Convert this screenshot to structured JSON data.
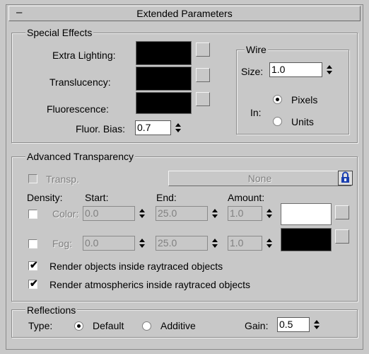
{
  "rollout": {
    "title": "Extended Parameters",
    "collapse_symbol": "–"
  },
  "special_effects": {
    "title": "Special Effects",
    "extra_lighting_label": "Extra Lighting:",
    "translucency_label": "Translucency:",
    "fluorescence_label": "Fluorescence:",
    "fluor_bias_label": "Fluor. Bias:",
    "fluor_bias_value": "0.7",
    "extra_lighting_color": "#000000",
    "translucency_color": "#000000",
    "fluorescence_color": "#000000"
  },
  "wire": {
    "title": "Wire",
    "size_label": "Size:",
    "size_value": "1.0",
    "in_label": "In:",
    "pixels_label": "Pixels",
    "units_label": "Units",
    "selected": "Pixels"
  },
  "advanced_transparency": {
    "title": "Advanced Transparency",
    "transp_label": "Transp.",
    "none_label": "None",
    "density_label": "Density:",
    "start_label": "Start:",
    "end_label": "End:",
    "amount_label": "Amount:",
    "color_label": "Color:",
    "fog_label": "Fog:",
    "color_start": "0.0",
    "color_end": "25.0",
    "color_amount": "1.0",
    "fog_start": "0.0",
    "fog_end": "25.0",
    "fog_amount": "1.0",
    "color_swatch": "#ffffff",
    "fog_swatch": "#000000",
    "render_objects_label": "Render objects inside raytraced objects",
    "render_atmospherics_label": "Render atmospherics inside raytraced objects",
    "render_objects_checked": true,
    "render_atmospherics_checked": true
  },
  "reflections": {
    "title": "Reflections",
    "type_label": "Type:",
    "default_label": "Default",
    "additive_label": "Additive",
    "selected": "Default",
    "gain_label": "Gain:",
    "gain_value": "0.5"
  },
  "icons": {
    "lock": "lock-icon",
    "check": "✔"
  }
}
